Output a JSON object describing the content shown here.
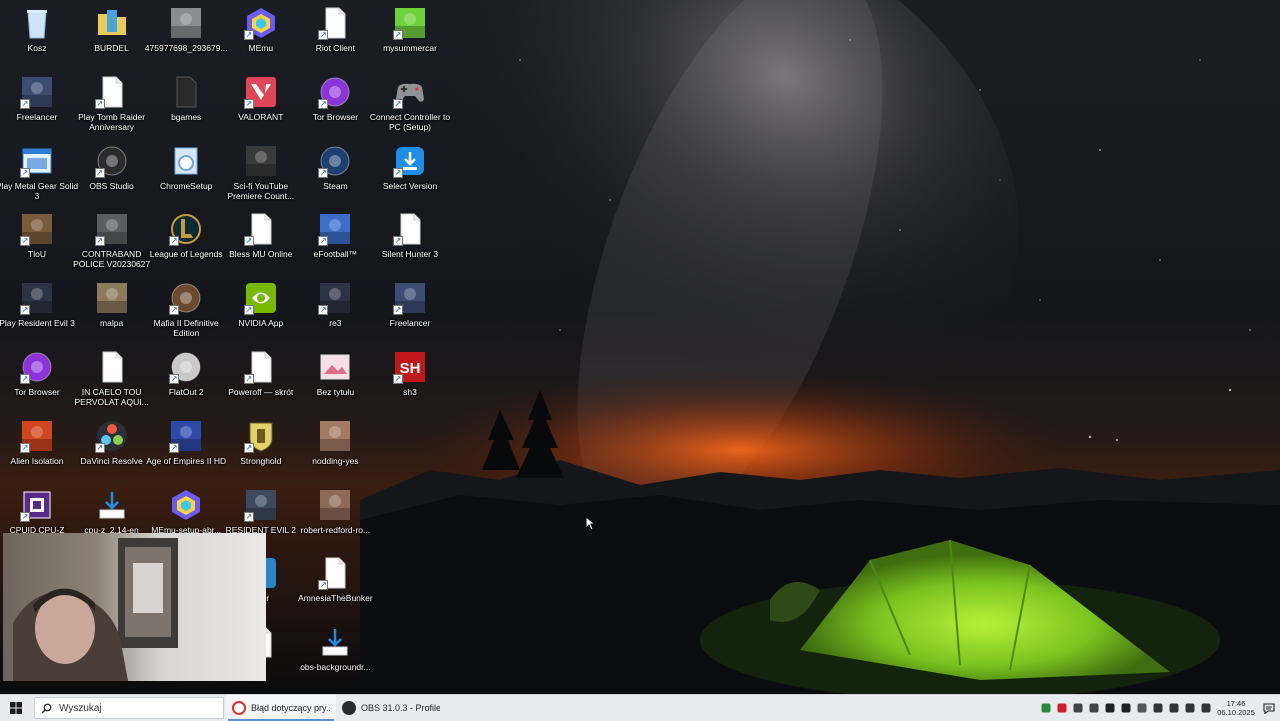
{
  "desktop": {
    "icons": [
      {
        "label": "Kosz",
        "icon": "recycle-bin-icon",
        "shortcut": false,
        "color": "#cfe3f7"
      },
      {
        "label": "BURDEL",
        "icon": "folder-icon",
        "shortcut": false,
        "color": "#e8c95a"
      },
      {
        "label": "475977698_293679...",
        "icon": "photo-file-icon",
        "shortcut": false,
        "color": "#8a8c91"
      },
      {
        "label": "MEmu",
        "icon": "memu-icon",
        "shortcut": true,
        "color": "#6a5cf0"
      },
      {
        "label": "Riot Client",
        "icon": "blank-file-icon",
        "shortcut": true,
        "color": "#ffffff"
      },
      {
        "label": "mysummercar",
        "icon": "my-summer-car-icon",
        "shortcut": true,
        "color": "#6ed23b"
      },
      {
        "label": "Freelancer",
        "icon": "freelancer-icon",
        "shortcut": true,
        "color": "#3d4c73"
      },
      {
        "label": "Play Tomb Raider Anniversary",
        "icon": "blank-file-icon",
        "shortcut": true,
        "color": "#ffffff"
      },
      {
        "label": "bgames",
        "icon": "dark-file-icon",
        "shortcut": false,
        "color": "#2c2c2c"
      },
      {
        "label": "VALORANT",
        "icon": "valorant-icon",
        "shortcut": true,
        "color": "#e04457"
      },
      {
        "label": "Tor Browser",
        "icon": "tor-browser-icon",
        "shortcut": true,
        "color": "#8c33d9"
      },
      {
        "label": "Connect Controller to PC (Setup)",
        "icon": "gamepad-icon",
        "shortcut": true,
        "color": "#8e9296"
      },
      {
        "label": "Play Metal Gear Solid 3",
        "icon": "window-app-icon",
        "shortcut": true,
        "color": "#2d7dd2"
      },
      {
        "label": "OBS Studio",
        "icon": "obs-icon",
        "shortcut": true,
        "color": "#2b2b2b"
      },
      {
        "label": "ChromeSetup",
        "icon": "installer-icon",
        "shortcut": false,
        "color": "#6fa8dc"
      },
      {
        "label": "Sci-fi YouTube Premiere Count...",
        "icon": "video-file-icon",
        "shortcut": false,
        "color": "#3a3a3a"
      },
      {
        "label": "Steam",
        "icon": "steam-icon",
        "shortcut": true,
        "color": "#1d3f72"
      },
      {
        "label": "Select Version",
        "icon": "download-app-icon",
        "shortcut": true,
        "color": "#1f8ee8"
      },
      {
        "label": "TloU",
        "icon": "tlou-icon",
        "shortcut": true,
        "color": "#7a5b3c"
      },
      {
        "label": "CONTRABAND POLICE V20230627",
        "icon": "contraband-police-icon",
        "shortcut": true,
        "color": "#5b5e63"
      },
      {
        "label": "League of Legends",
        "icon": "league-of-legends-icon",
        "shortcut": true,
        "color": "#c89b3c"
      },
      {
        "label": "Bless MU Online",
        "icon": "blank-file-icon",
        "shortcut": true,
        "color": "#ffffff"
      },
      {
        "label": "eFootball™",
        "icon": "efootball-icon",
        "shortcut": true,
        "color": "#3b6ec7"
      },
      {
        "label": "Silent Hunter 3",
        "icon": "blank-file-icon",
        "shortcut": true,
        "color": "#ffffff"
      },
      {
        "label": "Play Resident Evil 3",
        "icon": "resident-evil-3-icon",
        "shortcut": true,
        "color": "#2b3445"
      },
      {
        "label": "malpa",
        "icon": "photo-file-icon",
        "shortcut": false,
        "color": "#8c7a5a"
      },
      {
        "label": "Mafia II Definitive Edition",
        "icon": "mafia-icon",
        "shortcut": true,
        "color": "#6b4a2e"
      },
      {
        "label": "NVIDIA App",
        "icon": "nvidia-icon",
        "shortcut": true,
        "color": "#76b900"
      },
      {
        "label": "re3",
        "icon": "resident-evil-3-icon",
        "shortcut": true,
        "color": "#2b3445"
      },
      {
        "label": "Freelancer",
        "icon": "freelancer-icon",
        "shortcut": true,
        "color": "#3d4c73"
      },
      {
        "label": "Tor Browser",
        "icon": "tor-browser-icon",
        "shortcut": true,
        "color": "#8c33d9"
      },
      {
        "label": "IN CAELO TOU PERVOLAT AQUI...",
        "icon": "blank-file-icon",
        "shortcut": false,
        "color": "#ffffff"
      },
      {
        "label": "FlatOut 2",
        "icon": "flatout-icon",
        "shortcut": true,
        "color": "#c9c9c9"
      },
      {
        "label": "Poweroff — skrót",
        "icon": "blank-file-icon",
        "shortcut": true,
        "color": "#ffffff"
      },
      {
        "label": "Bez tytułu",
        "icon": "image-file-icon",
        "shortcut": false,
        "color": "#f3dfe5"
      },
      {
        "label": "sh3",
        "icon": "sh3-icon",
        "shortcut": true,
        "color": "#c01818"
      },
      {
        "label": "Alien Isolation",
        "icon": "alien-isolation-icon",
        "shortcut": true,
        "color": "#d1451f"
      },
      {
        "label": "DaVinci Resolve",
        "icon": "davinci-resolve-icon",
        "shortcut": true,
        "color": "#2f6fb5"
      },
      {
        "label": "Age of Empires II HD",
        "icon": "age-of-empires-icon",
        "shortcut": true,
        "color": "#2d4aa8"
      },
      {
        "label": "Stronghold",
        "icon": "stronghold-icon",
        "shortcut": true,
        "color": "#e3d06a"
      },
      {
        "label": "nodding-yes",
        "icon": "photo-file-icon",
        "shortcut": false,
        "color": "#a47a63"
      },
      {
        "label": "",
        "icon": "",
        "shortcut": false,
        "color": ""
      },
      {
        "label": "CPUID CPU-Z",
        "icon": "cpu-z-icon",
        "shortcut": true,
        "color": "#5a2a8a"
      },
      {
        "label": "cpu-z_2.14-en",
        "icon": "download-file-icon",
        "shortcut": false,
        "color": "#1f8ee8"
      },
      {
        "label": "MEmu-setup-abr...",
        "icon": "memu-icon",
        "shortcut": false,
        "color": "#6a5cf0"
      },
      {
        "label": "RESIDENT EVIL 2",
        "icon": "resident-evil-2-icon",
        "shortcut": true,
        "color": "#3c4a5c"
      },
      {
        "label": "robert-redford-ro...",
        "icon": "photo-file-icon",
        "shortcut": false,
        "color": "#8e6b58"
      },
      {
        "label": "",
        "icon": "",
        "shortcut": false,
        "color": ""
      },
      {
        "label": "",
        "icon": "",
        "shortcut": false,
        "color": ""
      },
      {
        "label": "",
        "icon": "",
        "shortcut": false,
        "color": ""
      },
      {
        "label": "",
        "icon": "",
        "shortcut": false,
        "color": ""
      },
      {
        "label": "cher",
        "icon": "launcher-icon",
        "shortcut": false,
        "color": "#2b87c9"
      },
      {
        "label": "AmnesiaTheBunker",
        "icon": "blank-file-icon",
        "shortcut": true,
        "color": "#ffffff"
      },
      {
        "label": "",
        "icon": "",
        "shortcut": false,
        "color": ""
      },
      {
        "label": "",
        "icon": "",
        "shortcut": false,
        "color": ""
      },
      {
        "label": "",
        "icon": "",
        "shortcut": false,
        "color": ""
      },
      {
        "label": "",
        "icon": "",
        "shortcut": false,
        "color": ""
      },
      {
        "label": "",
        "icon": "partial-file-icon",
        "shortcut": false,
        "color": "#ffffff"
      },
      {
        "label": "obs-backgroundr...",
        "icon": "download-file-icon",
        "shortcut": false,
        "color": "#1f8ee8"
      },
      {
        "label": "",
        "icon": "",
        "shortcut": false,
        "color": ""
      }
    ]
  },
  "taskbar": {
    "start_icon": "windows-start-icon",
    "search_placeholder": "Wyszukaj",
    "apps": [
      {
        "label": "Błąd dotyczący pry...",
        "icon": "opera-icon",
        "color": "#e0302b",
        "active": true
      },
      {
        "label": "OBS 31.0.3 - Profile:...",
        "icon": "obs-icon",
        "color": "#2b2b2b",
        "active": false
      }
    ],
    "tray": [
      {
        "icon": "tray-app-green-icon",
        "color": "#2a8a3a"
      },
      {
        "icon": "tray-shield-icon",
        "color": "#d11d2a"
      },
      {
        "icon": "tray-app-icon",
        "color": "#444444"
      },
      {
        "icon": "tray-display-icon",
        "color": "#444444"
      },
      {
        "icon": "tray-sync-icon",
        "color": "#222222"
      },
      {
        "icon": "tray-settings-icon",
        "color": "#222222"
      },
      {
        "icon": "tray-network-icon",
        "color": "#555555"
      },
      {
        "icon": "tray-volume-icon",
        "color": "#333333"
      },
      {
        "icon": "tray-ethernet-icon",
        "color": "#333333"
      },
      {
        "icon": "tray-battery-icon",
        "color": "#333333"
      },
      {
        "icon": "tray-microphone-icon",
        "color": "#333333"
      }
    ],
    "clock_time": "17:46",
    "clock_date": "06.10.2025",
    "notification_icon": "notification-center-icon"
  }
}
